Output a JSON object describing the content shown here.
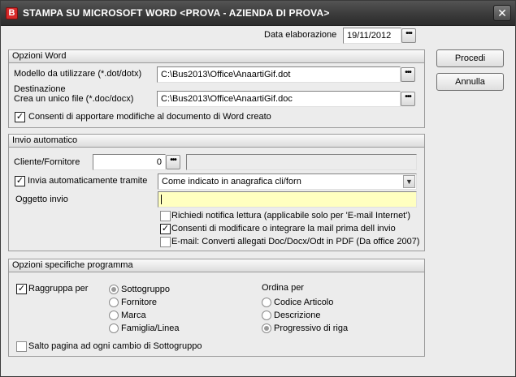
{
  "window": {
    "title": "STAMPA SU MICROSOFT WORD <PROVA - AZIENDA DI PROVA>",
    "icon_letter": "B",
    "close_glyph": "✕"
  },
  "header": {
    "data_label": "Data elaborazione",
    "data_value": "19/11/2012"
  },
  "buttons": {
    "procedi": "Procedi",
    "annulla": "Annulla",
    "dots": "•••"
  },
  "opzioni_word": {
    "title": "Opzioni Word",
    "modello_label": "Modello da utilizzare (*.dot/dotx)",
    "modello_value": "C:\\Bus2013\\Office\\AnaartiGif.dot",
    "destinazione_label1": "Destinazione",
    "destinazione_label2": "Crea un unico file (*.doc/docx)",
    "destinazione_value": "C:\\Bus2013\\Office\\AnaartiGif.doc",
    "consenti_label": "Consenti di apportare modifiche al documento di Word creato",
    "consenti_checked": true
  },
  "invio_automatico": {
    "title": "Invio automatico",
    "cliente_label": "Cliente/Fornitore",
    "cliente_value": "0",
    "invia_label": "Invia automaticamente tramite",
    "invia_checked": true,
    "invia_value": "Come indicato in anagrafica cli/forn",
    "oggetto_label": "Oggetto invio",
    "oggetto_value": "",
    "richiedi_label": "Richiedi notifica lettura (applicabile solo per 'E-mail Internet')",
    "richiedi_checked": false,
    "consenti_mail_label": "Consenti di modificare o integrare la mail prima dell invio",
    "consenti_mail_checked": true,
    "email_converti_label": "E-mail: Converti allegati Doc/Docx/Odt in PDF (Da office 2007)",
    "email_converti_checked": false
  },
  "opzioni_specifiche": {
    "title": "Opzioni specifiche programma",
    "raggruppa_label": "Raggruppa per",
    "raggruppa_checked": true,
    "raggruppa_options": [
      {
        "label": "Sottogruppo",
        "selected": true
      },
      {
        "label": "Fornitore",
        "selected": false
      },
      {
        "label": "Marca",
        "selected": false
      },
      {
        "label": "Famiglia/Linea",
        "selected": false
      }
    ],
    "ordina_label": "Ordina per",
    "ordina_options": [
      {
        "label": "Codice Articolo",
        "selected": false
      },
      {
        "label": "Descrizione",
        "selected": false
      },
      {
        "label": "Progressivo di riga",
        "selected": true
      }
    ],
    "salto_label": "Salto pagina ad ogni cambio di Sottogruppo",
    "salto_checked": false
  },
  "colors": {
    "title_bar": "#3b3b3b",
    "oggetto_bg": "#ffffc0",
    "app_icon": "#d62929"
  }
}
